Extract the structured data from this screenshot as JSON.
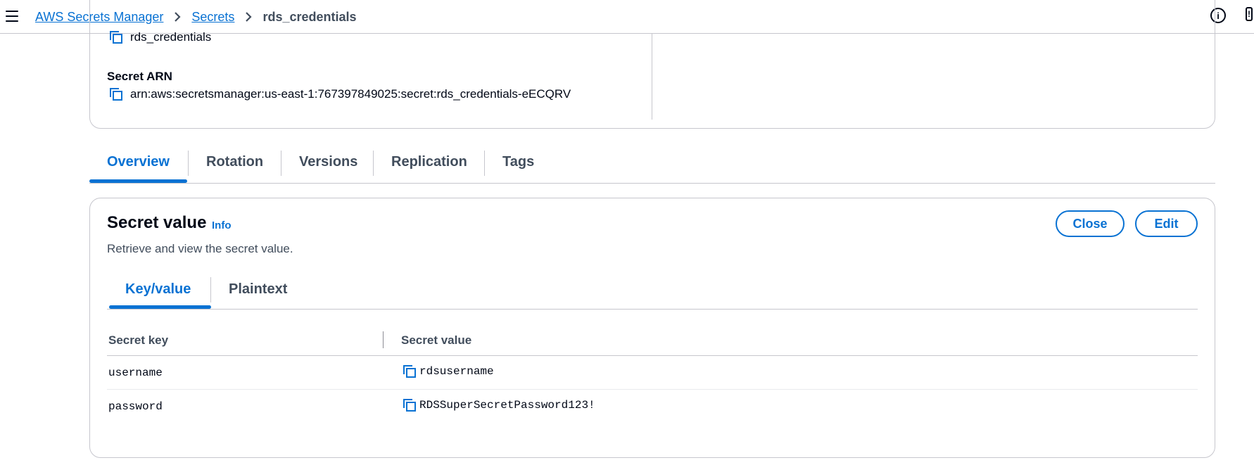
{
  "breadcrumb": {
    "items": [
      {
        "label": "AWS Secrets Manager"
      },
      {
        "label": "Secrets"
      }
    ],
    "current": "rds_credentials"
  },
  "details": {
    "secret_name": "rds_credentials",
    "arn_label": "Secret ARN",
    "arn_value": "arn:aws:secretsmanager:us-east-1:767397849025:secret:rds_credentials-eECQRV"
  },
  "tabs": [
    {
      "label": "Overview",
      "active": true
    },
    {
      "label": "Rotation",
      "active": false
    },
    {
      "label": "Versions",
      "active": false
    },
    {
      "label": "Replication",
      "active": false
    },
    {
      "label": "Tags",
      "active": false
    }
  ],
  "secret_value_panel": {
    "title": "Secret value",
    "info_label": "Info",
    "description": "Retrieve and view the secret value.",
    "close_label": "Close",
    "edit_label": "Edit",
    "subtabs": [
      {
        "label": "Key/value",
        "active": true
      },
      {
        "label": "Plaintext",
        "active": false
      }
    ],
    "table": {
      "columns": [
        "Secret key",
        "Secret value"
      ],
      "rows": [
        {
          "key": "username",
          "value": "rdsusername"
        },
        {
          "key": "password",
          "value": "RDSSuperSecretPassword123!"
        }
      ]
    }
  },
  "icons": {
    "menu": "hamburger-menu-icon",
    "chevron": "chevron-right-icon",
    "copy": "copy-icon",
    "info": "info-circle-icon",
    "feedback": "feedback-icon"
  },
  "colors": {
    "accent": "#0972d3",
    "text": "#000716",
    "secondary_text": "#414d5c",
    "border": "#c6c6cd"
  }
}
